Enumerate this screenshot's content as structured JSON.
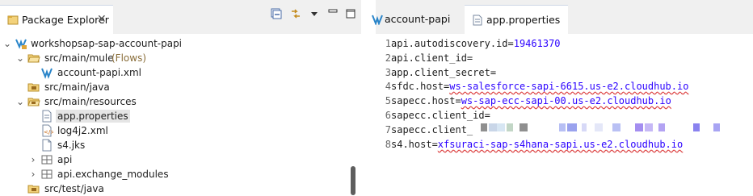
{
  "package_explorer": {
    "tab_label": "Package Explorer",
    "tree": [
      {
        "label": "workshopsap-sap-account-papi",
        "suffix": "",
        "icon": "mule-project-icon",
        "expanded": true
      },
      {
        "label": "src/main/mule",
        "suffix": "(Flows)",
        "icon": "folder-open-icon",
        "expanded": true
      },
      {
        "label": "account-papi.xml",
        "suffix": "",
        "icon": "mule-flow-icon",
        "expanded": null
      },
      {
        "label": "src/main/java",
        "suffix": "",
        "icon": "source-folder-icon",
        "expanded": null
      },
      {
        "label": "src/main/resources",
        "suffix": "",
        "icon": "source-folder-open-icon",
        "expanded": true
      },
      {
        "label": "app.properties",
        "suffix": "",
        "icon": "properties-file-icon",
        "expanded": null,
        "selected": true
      },
      {
        "label": "log4j2.xml",
        "suffix": "",
        "icon": "xml-file-icon",
        "expanded": null
      },
      {
        "label": "s4.jks",
        "suffix": "",
        "icon": "file-icon",
        "expanded": null
      },
      {
        "label": "api",
        "suffix": "",
        "icon": "package-icon",
        "expanded": false
      },
      {
        "label": "api.exchange_modules",
        "suffix": "",
        "icon": "package-icon",
        "expanded": false
      },
      {
        "label": "src/test/java",
        "suffix": "",
        "icon": "source-folder-icon",
        "expanded": null
      }
    ]
  },
  "editor": {
    "tabs": [
      {
        "label": "account-papi",
        "active": false
      },
      {
        "label": "app.properties",
        "active": true
      }
    ],
    "lines": [
      {
        "num": "1",
        "key": "api.autodiscovery.id=",
        "value": "19461370",
        "squiggle": false
      },
      {
        "num": "2",
        "key": "api.client_id=",
        "value": "",
        "squiggle": false
      },
      {
        "num": "3",
        "key": "app.client_secret=",
        "value": "",
        "squiggle": false
      },
      {
        "num": "4",
        "key": "sfdc.host=",
        "value": "ws-salesforce-sapi-6615.us-e2.cloudhub.io",
        "squiggle": true
      },
      {
        "num": "5",
        "key": "sapecc.host=",
        "value": "ws-sap-ecc-sapi-00.us-e2.cloudhub.io",
        "squiggle": true
      },
      {
        "num": "6",
        "key": "sapecc.client_id=",
        "value": "",
        "squiggle": false
      },
      {
        "num": "7",
        "key": "sapecc.client_",
        "value": "",
        "squiggle": false
      },
      {
        "num": "8",
        "key": "s4.host=",
        "value": "xfsuraci-sap-s4hana-sapi.us-e2.cloudhub.io",
        "squiggle": true
      }
    ]
  },
  "colors": {
    "value_text": "#2a00ff",
    "selection": "#e5e5e5",
    "tab_bar": "#f0f0f0"
  }
}
